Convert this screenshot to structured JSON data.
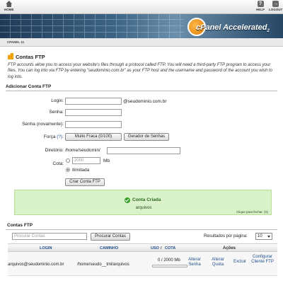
{
  "toolbar": {
    "home_label": "HOME",
    "help_label": "HELP",
    "logout_label": "LOGOUT"
  },
  "banner": {
    "logo_text": "cPanel Accelerated",
    "logo_version": "2"
  },
  "breadcrumb": {
    "label": "CPANEL 11"
  },
  "page": {
    "title": "Contas FTP",
    "intro": "FTP accounts allow you to access your website's files through a protocol called FTP. You will need a third-party FTP program to access your files. You can log into via FTP by entering \"seudominio.com.br\" as your FTP host and the username and password of the account you wish to log into."
  },
  "add_form": {
    "section_title": "Adicionar Conta FTP",
    "login_label": "Login:",
    "login_value": "",
    "domain_suffix": "@seudominio.com.br",
    "password_label": "Senha:",
    "password_value": "",
    "password_again_label": "Senha (novamente):",
    "password_again_value": "",
    "strength_label": "Força",
    "strength_help": "(?):",
    "strength_value": "Muito Fraca (0/100)",
    "generator_label": "Gerador de Senhas",
    "directory_label": "Diretório:",
    "directory_prefix": "/home/seudomin/",
    "directory_value": "",
    "quota_label": "Cota:",
    "quota_value": "2000",
    "quota_unit": "Mb",
    "quota_unlimited_label": "Ilimitada",
    "quota_selected": "Ilimitada",
    "create_label": "Criar Conta FTP"
  },
  "success": {
    "message": "Conta Criada",
    "detail": "arquivos",
    "close_text": "Clique para fechar. (X)"
  },
  "accounts": {
    "section_title": "Contas FTP",
    "search_placeholder": "Procurar Contas",
    "search_button": "Procurar Contas",
    "per_page_label": "Resultados por página:",
    "per_page_value": "10",
    "columns": {
      "login": "Login",
      "path": "Caminho",
      "usage": "Uso",
      "quota": "Cota",
      "actions": "Ações"
    },
    "rows": [
      {
        "login": "arquivos@seudominio.com.br",
        "path": "/home/seudo__tml/arquivos",
        "usage": "0 / 2000 Mb",
        "usage_fraction": 0,
        "action_password": "Alterar Senha",
        "action_quota": "Alterar Quota",
        "action_delete": "Excluir",
        "action_configure": "Configurar Cliente FTP"
      }
    ]
  },
  "colors": {
    "banner": "#2d5070",
    "link": "#1f4e8c",
    "success_bg": "#d9f2c9",
    "accent": "#f0a30a"
  }
}
